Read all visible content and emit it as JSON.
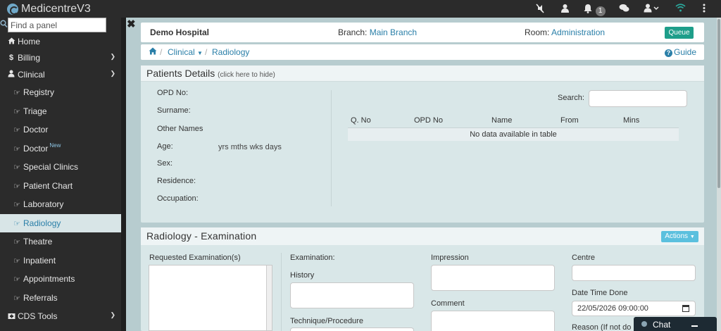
{
  "app": {
    "title": "MedicentreV3"
  },
  "topbar": {
    "icons": [
      "mute-icon",
      "user-badge-icon",
      "bell-icon",
      "chat-icon",
      "user-icon",
      "wifi-icon",
      "more-icon"
    ],
    "notification_count": "1",
    "wifi_color": "#2ba89c"
  },
  "sidebar": {
    "search_placeholder": "Find a panel",
    "items": [
      {
        "label": "Home",
        "icon": "home-icon"
      },
      {
        "label": "Billing",
        "icon": "dollar-icon"
      },
      {
        "label": "Clinical",
        "icon": "user-icon"
      },
      {
        "label": "Registry",
        "icon": "hand-point-icon"
      },
      {
        "label": "Triage",
        "icon": "hand-point-icon"
      },
      {
        "label": "Doctor",
        "icon": "hand-point-icon"
      },
      {
        "label": "Doctor",
        "icon": "hand-point-icon",
        "badge": "New"
      },
      {
        "label": "Special Clinics",
        "icon": "hand-point-icon"
      },
      {
        "label": "Patient Chart",
        "icon": "hand-point-icon"
      },
      {
        "label": "Laboratory",
        "icon": "hand-point-icon"
      },
      {
        "label": "Radiology",
        "icon": "hand-point-icon",
        "active": true
      },
      {
        "label": "Theatre",
        "icon": "hand-point-icon"
      },
      {
        "label": "Inpatient",
        "icon": "hand-point-icon"
      },
      {
        "label": "Appointments",
        "icon": "hand-point-icon"
      },
      {
        "label": "Referrals",
        "icon": "hand-point-icon"
      },
      {
        "label": "CDS Tools",
        "icon": "hospital-icon"
      }
    ]
  },
  "header": {
    "hospital": "Demo Hospital",
    "branch_label": "Branch:",
    "branch_value": "Main Branch",
    "room_label": "Room:",
    "room_value": "Administration",
    "queue_label": "Queue"
  },
  "breadcrumb": {
    "items": [
      "Clinical",
      "Radiology"
    ],
    "guide_label": "Guide"
  },
  "patients": {
    "title": "Patients Details",
    "hint": "(click here to hide)",
    "fields": [
      "OPD No:",
      "Surname:",
      "Other Names",
      "Age:",
      "Sex:",
      "Residence:",
      "Occupation:"
    ],
    "age_value": "yrs mths wks days",
    "search_label": "Search:",
    "table_headers": [
      "Q. No",
      "OPD No",
      "Name",
      "From",
      "Mins"
    ],
    "empty_message": "No data available in table"
  },
  "exam": {
    "title": "Radiology - Examination",
    "actions_label": "Actions",
    "requested_label": "Requested Examination(s)",
    "examination_label": "Examination:",
    "history_label": "History",
    "technique_label": "Technique/Procedure",
    "impression_label": "Impression",
    "comment_label": "Comment",
    "centre_label": "Centre",
    "datetime_label": "Date Time Done",
    "datetime_value": "22/05/2026 09:00:00",
    "reason_label": "Reason (If not do"
  },
  "chat": {
    "label": "Chat"
  },
  "colors": {
    "accent": "#2a7fa8",
    "queue": "#1e9e8a",
    "actions": "#5bc0de",
    "sidebar": "#2b2b2b"
  }
}
